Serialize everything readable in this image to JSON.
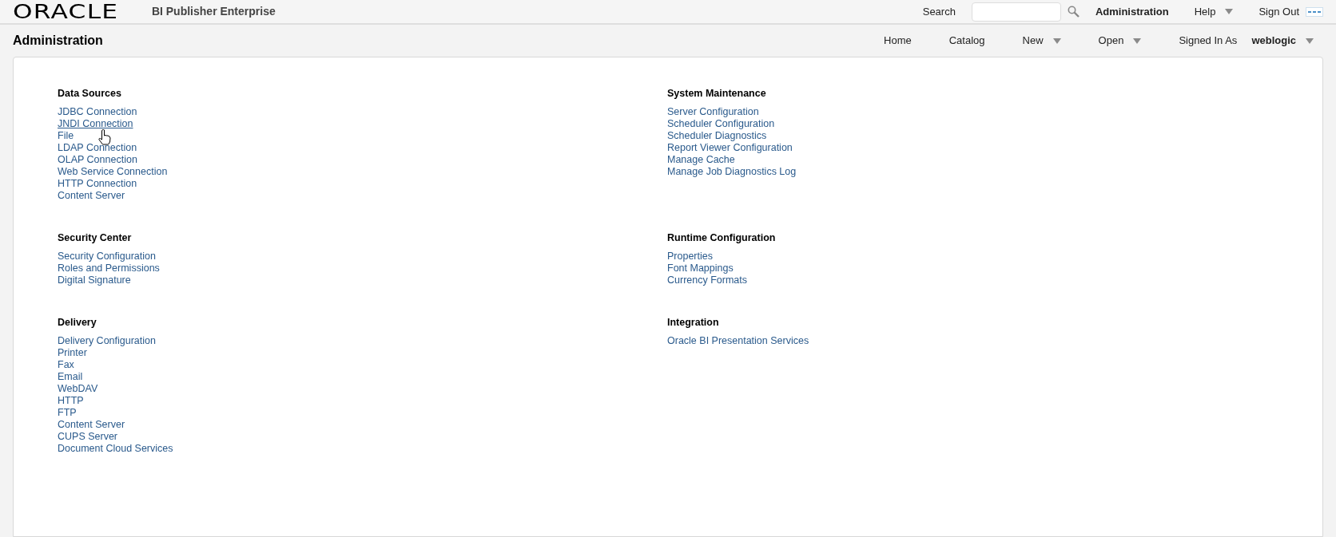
{
  "header": {
    "brand": "ORACLE",
    "product": "BI Publisher Enterprise",
    "search_label": "Search",
    "links": [
      {
        "label": "Administration",
        "kind": "bold"
      },
      {
        "label": "Help",
        "kind": "menu"
      },
      {
        "label": "Sign Out",
        "kind": "plain"
      }
    ]
  },
  "nav": {
    "page_title": "Administration",
    "items": [
      {
        "label": "Home",
        "kind": "plain"
      },
      {
        "label": "Catalog",
        "kind": "plain"
      },
      {
        "label": "New",
        "kind": "menu"
      },
      {
        "label": "Open",
        "kind": "menu"
      }
    ],
    "signed_in_label": "Signed In As",
    "user": "weblogic"
  },
  "sections": [
    {
      "title": "Data Sources",
      "links": [
        {
          "label": "JDBC Connection",
          "hovered": false
        },
        {
          "label": "JNDI Connection",
          "hovered": true
        },
        {
          "label": "File",
          "hovered": false
        },
        {
          "label": "LDAP Connection",
          "hovered": false
        },
        {
          "label": "OLAP Connection",
          "hovered": false
        },
        {
          "label": "Web Service Connection",
          "hovered": false
        },
        {
          "label": "HTTP Connection",
          "hovered": false
        },
        {
          "label": "Content Server",
          "hovered": false
        }
      ]
    },
    {
      "title": "System Maintenance",
      "links": [
        {
          "label": "Server Configuration",
          "hovered": false
        },
        {
          "label": "Scheduler Configuration",
          "hovered": false
        },
        {
          "label": "Scheduler Diagnostics",
          "hovered": false
        },
        {
          "label": "Report Viewer Configuration",
          "hovered": false
        },
        {
          "label": "Manage Cache",
          "hovered": false
        },
        {
          "label": "Manage Job Diagnostics Log",
          "hovered": false
        }
      ]
    },
    {
      "title": "Security Center",
      "links": [
        {
          "label": "Security Configuration",
          "hovered": false
        },
        {
          "label": "Roles and Permissions",
          "hovered": false
        },
        {
          "label": "Digital Signature",
          "hovered": false
        }
      ]
    },
    {
      "title": "Runtime Configuration",
      "links": [
        {
          "label": "Properties",
          "hovered": false
        },
        {
          "label": "Font Mappings",
          "hovered": false
        },
        {
          "label": "Currency Formats",
          "hovered": false
        }
      ]
    },
    {
      "title": "Delivery",
      "links": [
        {
          "label": "Delivery Configuration",
          "hovered": false
        },
        {
          "label": "Printer",
          "hovered": false
        },
        {
          "label": "Fax",
          "hovered": false
        },
        {
          "label": "Email",
          "hovered": false
        },
        {
          "label": "WebDAV",
          "hovered": false
        },
        {
          "label": "HTTP",
          "hovered": false
        },
        {
          "label": "FTP",
          "hovered": false
        },
        {
          "label": "Content Server",
          "hovered": false
        },
        {
          "label": "CUPS Server",
          "hovered": false
        },
        {
          "label": "Document Cloud Services",
          "hovered": false
        }
      ]
    },
    {
      "title": "Integration",
      "links": [
        {
          "label": "Oracle BI Presentation Services",
          "hovered": false
        }
      ]
    }
  ]
}
